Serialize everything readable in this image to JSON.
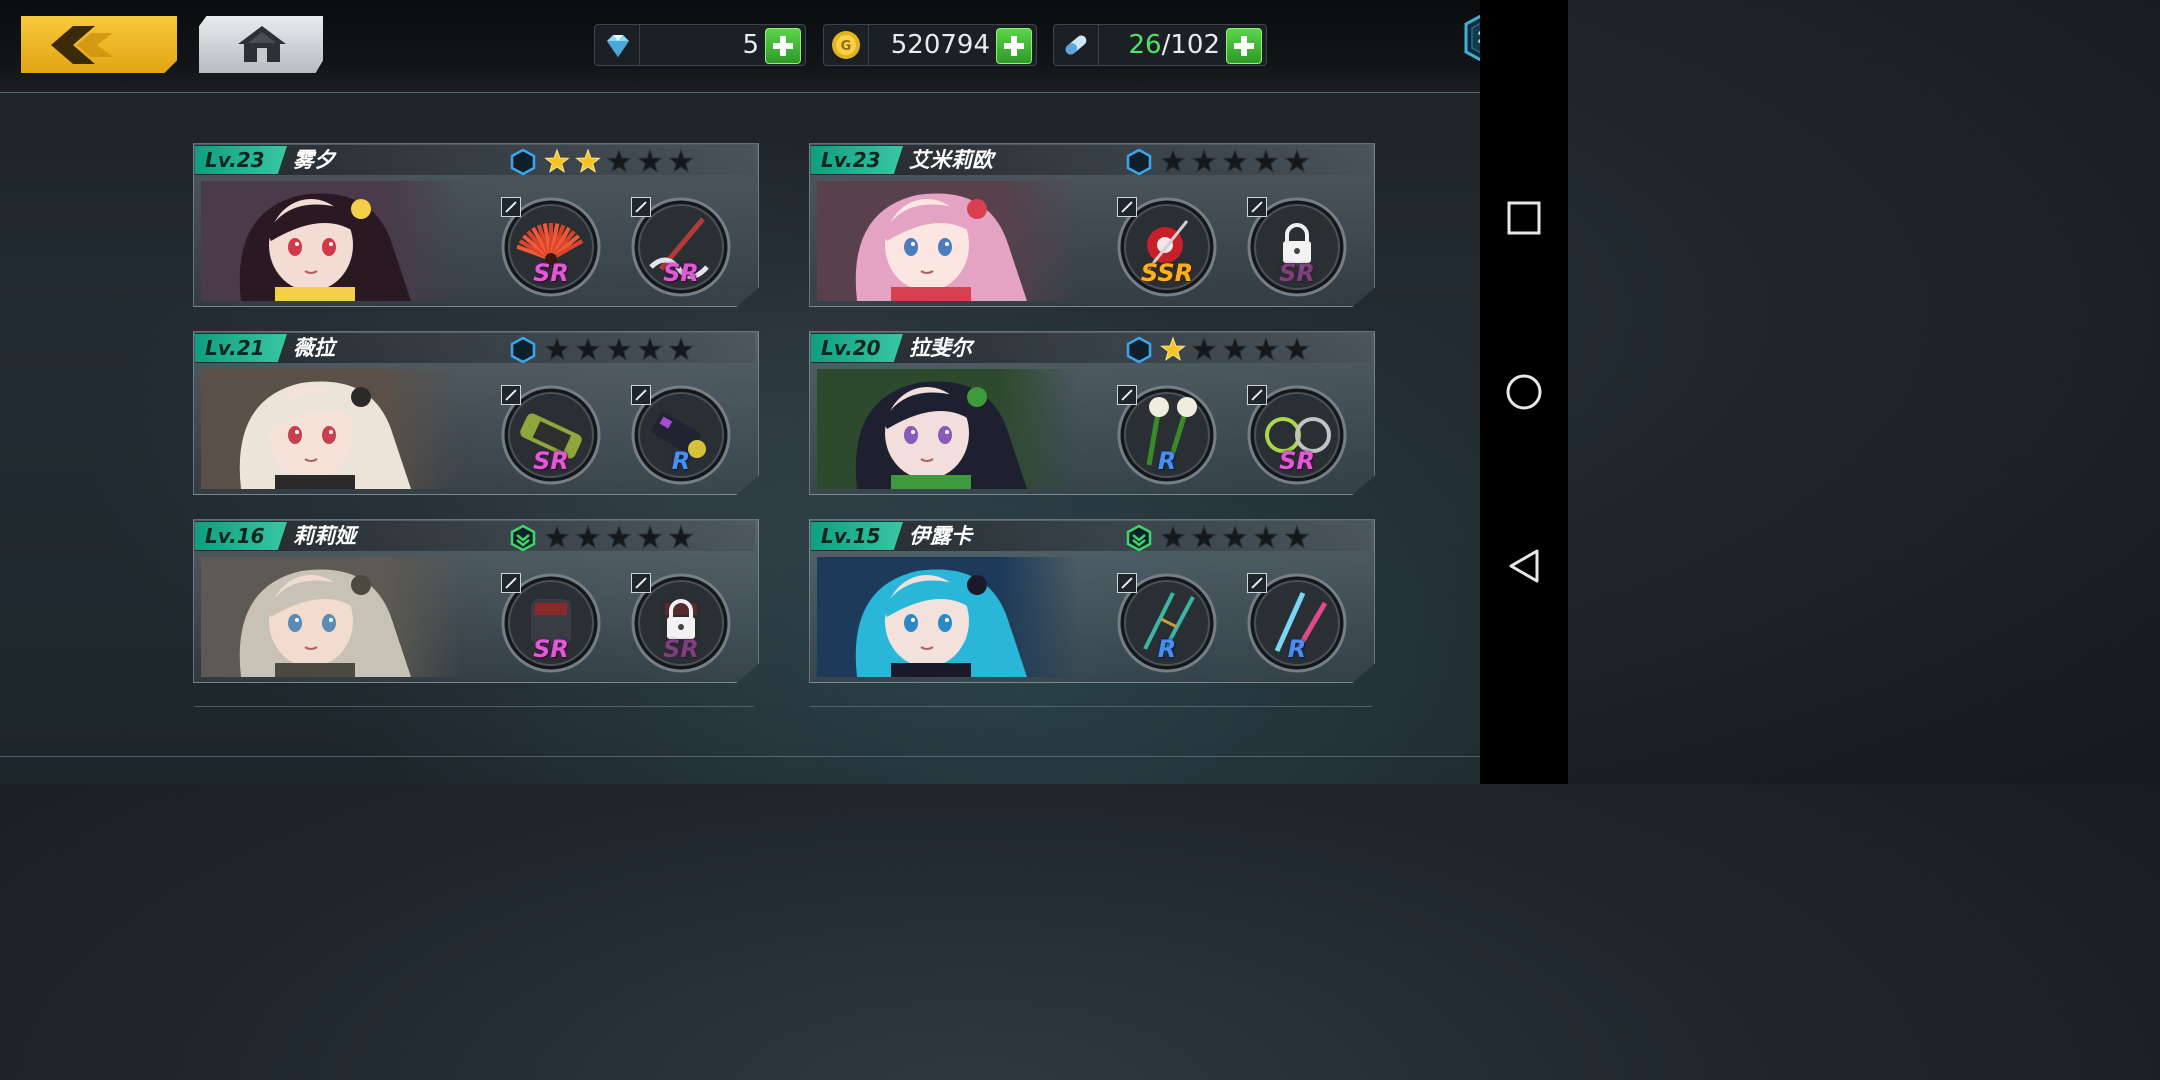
{
  "resources": {
    "crystal": {
      "value": "5",
      "icon": "crystal-icon"
    },
    "gold": {
      "value": "520794",
      "icon": "gold-coin-icon"
    },
    "stamina": {
      "current": "26",
      "separator": "/",
      "max": "102",
      "icon": "stamina-capsule-icon"
    }
  },
  "characters": [
    {
      "level": "Lv.23",
      "name": "雾夕",
      "hex": "blue",
      "stars": 2,
      "weapons": [
        {
          "rarity": "SR",
          "locked": false,
          "theme": "fan"
        },
        {
          "rarity": "SR",
          "locked": false,
          "theme": "rope-blade"
        }
      ],
      "portrait": {
        "bg": "#4a3a4a",
        "hair": "#2a1822",
        "skin": "#f3dcd4",
        "eye": "#d2384a",
        "accent": "#f4d04a"
      }
    },
    {
      "level": "Lv.23",
      "name": "艾米莉欧",
      "hex": "blue",
      "stars": 0,
      "weapons": [
        {
          "rarity": "SSR",
          "locked": false,
          "theme": "red-flower"
        },
        {
          "rarity": "SR",
          "locked": true,
          "theme": "dark-sword"
        }
      ],
      "portrait": {
        "bg": "#58404c",
        "hair": "#e4a3c2",
        "skin": "#fbe6e2",
        "eye": "#4a7cc0",
        "accent": "#d84050"
      }
    },
    {
      "level": "Lv.21",
      "name": "薇拉",
      "hex": "blue",
      "stars": 0,
      "weapons": [
        {
          "rarity": "SR",
          "locked": false,
          "theme": "death-canister"
        },
        {
          "rarity": "R",
          "locked": false,
          "theme": "cannon"
        }
      ],
      "portrait": {
        "bg": "#5a5048",
        "hair": "#ece4d8",
        "skin": "#f6e2d8",
        "eye": "#c84050",
        "accent": "#2a2a2a"
      }
    },
    {
      "level": "Lv.20",
      "name": "拉斐尔",
      "hex": "blue",
      "stars": 1,
      "weapons": [
        {
          "rarity": "R",
          "locked": false,
          "theme": "flower-spears"
        },
        {
          "rarity": "SR",
          "locked": false,
          "theme": "green-rings"
        }
      ],
      "portrait": {
        "bg": "#2e4a2e",
        "hair": "#1e2030",
        "skin": "#f2dedc",
        "eye": "#8a5ab8",
        "accent": "#3e9a3a"
      }
    },
    {
      "level": "Lv.16",
      "name": "莉莉娅",
      "hex": "green",
      "stars": 0,
      "weapons": [
        {
          "rarity": "SR",
          "locked": false,
          "theme": "gauntlet"
        },
        {
          "rarity": "SR",
          "locked": true,
          "theme": "dark-gauntlet"
        }
      ],
      "portrait": {
        "bg": "#5c5a52",
        "hair": "#c8c2b6",
        "skin": "#f2dcd0",
        "eye": "#5a8ab8",
        "accent": "#4a4a40"
      }
    },
    {
      "level": "Lv.15",
      "name": "伊露卡",
      "hex": "green",
      "stars": 0,
      "weapons": [
        {
          "rarity": "R",
          "locked": false,
          "theme": "twin-daggers"
        },
        {
          "rarity": "R",
          "locked": false,
          "theme": "crystal-blades"
        }
      ],
      "portrait": {
        "bg": "#1e3a5a",
        "hair": "#2ab6d8",
        "skin": "#f3e2dc",
        "eye": "#2a8ac8",
        "accent": "#1a1a2a"
      }
    }
  ],
  "colors": {
    "accent": "#f4c325",
    "level_green": "#38c7a3",
    "plus_green": "#3fb835",
    "star_gold": "#f4c325"
  }
}
